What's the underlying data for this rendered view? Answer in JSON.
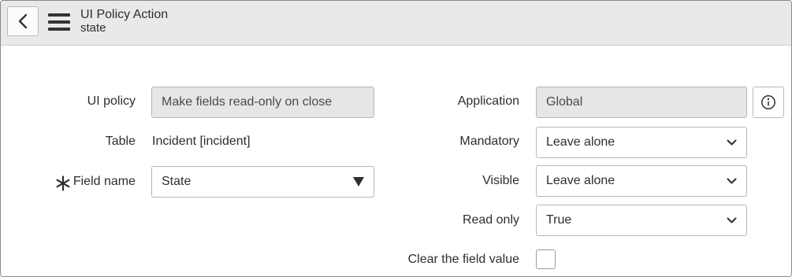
{
  "header": {
    "title": "UI Policy Action",
    "subtitle": "state",
    "back_icon": "chevron-left-icon",
    "menu_icon": "hamburger-icon"
  },
  "form": {
    "ui_policy": {
      "label": "UI policy",
      "value": "Make fields read-only on close"
    },
    "table": {
      "label": "Table",
      "value": "Incident [incident]"
    },
    "field_name": {
      "label": "Field name",
      "value": "State",
      "required_icon": "asterisk-icon",
      "dropdown_icon": "triangle-down-icon"
    },
    "application": {
      "label": "Application",
      "value": "Global",
      "info_icon": "info-icon"
    },
    "mandatory": {
      "label": "Mandatory",
      "value": "Leave alone"
    },
    "visible": {
      "label": "Visible",
      "value": "Leave alone"
    },
    "read_only": {
      "label": "Read only",
      "value": "True"
    },
    "clear_value": {
      "label": "Clear the field value",
      "checked": false
    }
  },
  "colors": {
    "header_bg": "#e9e9e9",
    "readonly_bg": "#e6e6e6",
    "text": "#2e2e2e"
  }
}
